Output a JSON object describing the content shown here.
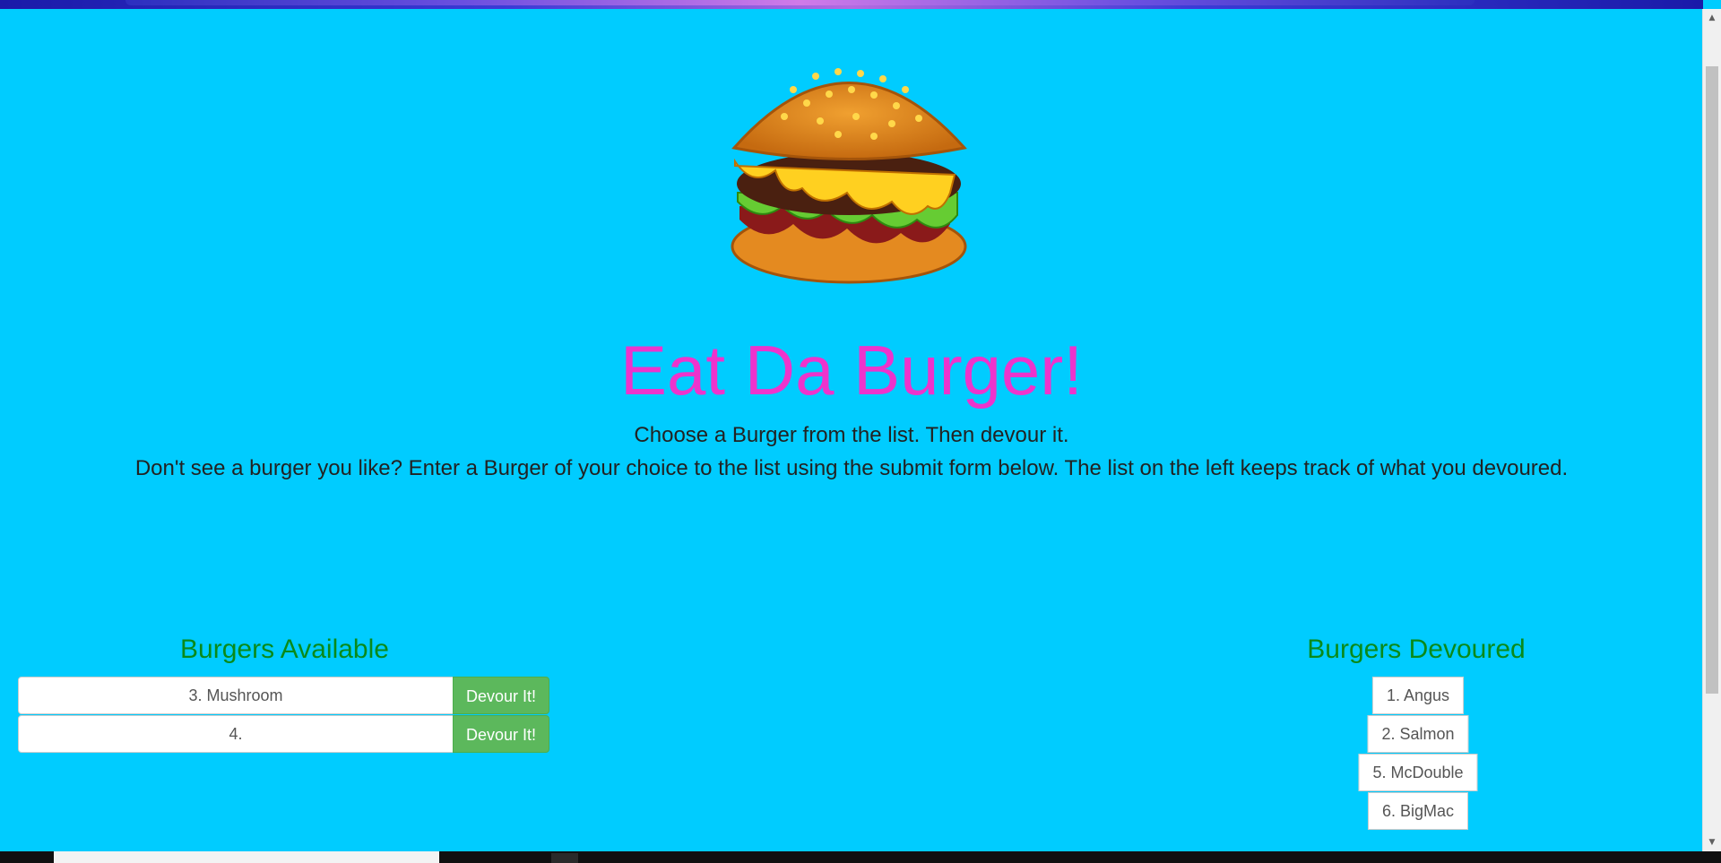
{
  "header": {
    "title": "Eat Da Burger!",
    "subtitle": "Choose a Burger from the list. Then devour it.",
    "description": "Don't see a burger you like? Enter a Burger of your choice to the list using the submit form below. The list on the left keeps track of what you devoured."
  },
  "available": {
    "heading": "Burgers Available",
    "items": [
      {
        "label": "3. Mushroom",
        "button": "Devour It!"
      },
      {
        "label": "4.",
        "button": "Devour It!"
      }
    ]
  },
  "devoured": {
    "heading": "Burgers Devoured",
    "items": [
      "1. Angus",
      "2. Salmon",
      "5. McDouble",
      "6. BigMac"
    ]
  },
  "colors": {
    "page_background": "#00ccff",
    "title": "#ee33cc",
    "section_heading": "#0a8a1a",
    "devour_button": "#5cb85c"
  },
  "icons": {
    "logo": "burger-icon",
    "scroll_up": "up-arrow-icon",
    "scroll_down": "down-arrow-icon"
  }
}
